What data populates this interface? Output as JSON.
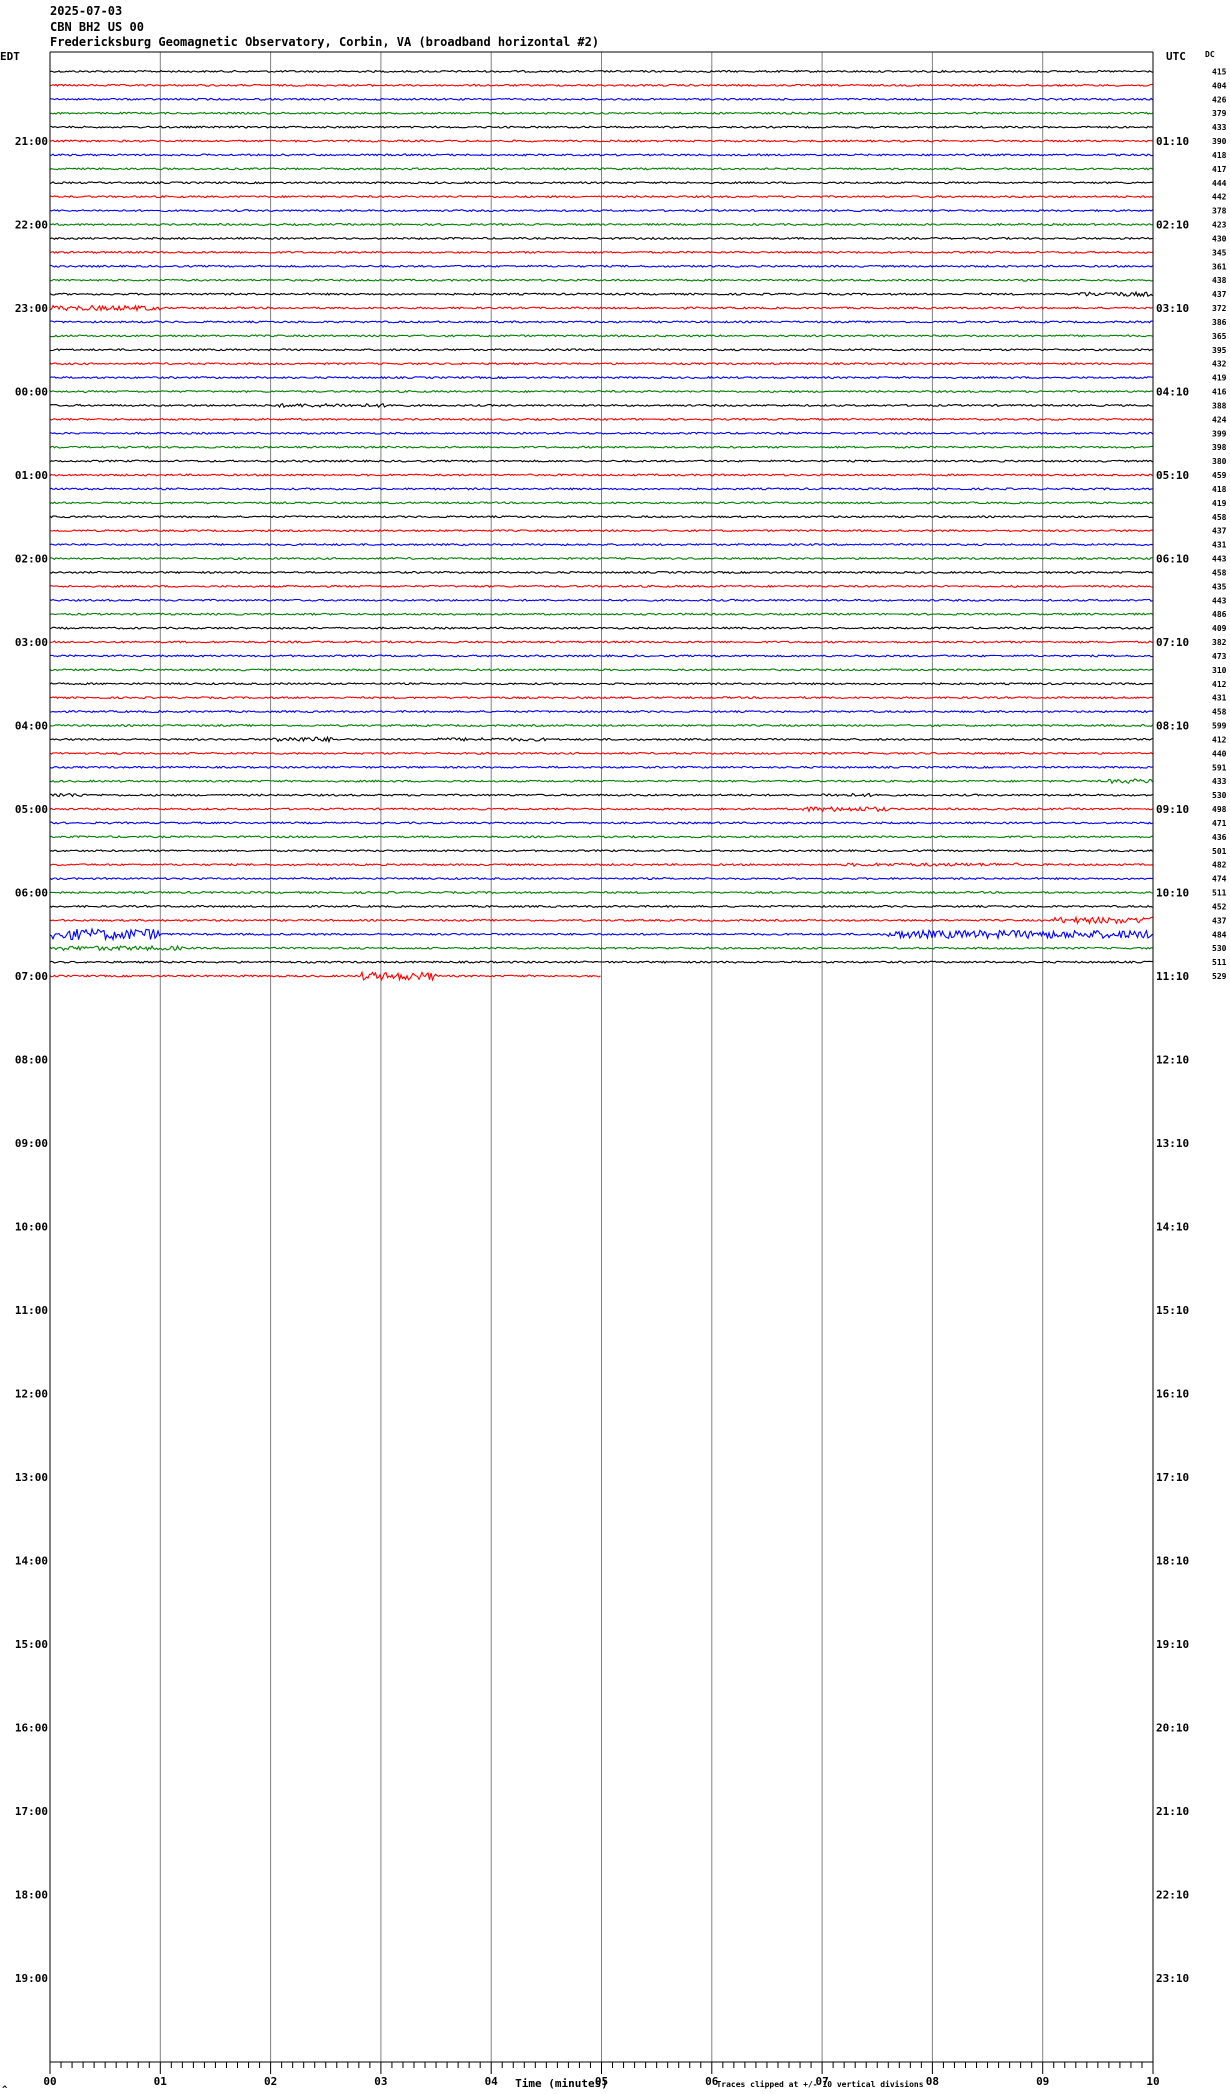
{
  "header": {
    "date": "2025-07-03",
    "channel": "CBN BH2 US 00",
    "station": "Fredericksburg Geomagnetic Observatory, Corbin, VA (broadband horizontal #2)"
  },
  "left_tz": "EDT",
  "right_tz": "UTC",
  "dc_label": "DC",
  "footnote": "Traces clipped at +/- 10 vertical divisions",
  "corner_mark": "^",
  "colors": [
    "#000000",
    "#ff0000",
    "#0000ff",
    "#008000"
  ],
  "chart_data": {
    "type": "line",
    "title": "CBN BH2 US 00",
    "xlabel": "Time (minutes)",
    "ylabel": "",
    "x_ticks": [
      "00",
      "01",
      "02",
      "03",
      "04",
      "05",
      "06",
      "07",
      "08",
      "09",
      "10"
    ],
    "xlim": [
      0,
      10
    ],
    "left_hour_labels": [
      "21:00",
      "22:00",
      "23:00",
      "00:00",
      "01:00",
      "02:00",
      "03:00",
      "04:00",
      "05:00",
      "06:00",
      "07:00",
      "08:00",
      "09:00",
      "10:00",
      "11:00",
      "12:00",
      "13:00",
      "14:00",
      "15:00",
      "16:00",
      "17:00",
      "18:00",
      "19:00"
    ],
    "right_hour_labels": [
      "01:10",
      "02:10",
      "03:10",
      "04:10",
      "05:10",
      "06:10",
      "07:10",
      "08:10",
      "09:10",
      "10:10",
      "11:10",
      "12:10",
      "13:10",
      "14:10",
      "15:10",
      "16:10",
      "17:10",
      "18:10",
      "19:10",
      "20:10",
      "21:10",
      "22:10",
      "23:10"
    ],
    "dc_offsets": [
      415,
      404,
      426,
      379,
      433,
      390,
      418,
      417,
      444,
      442,
      378,
      423,
      430,
      345,
      361,
      438,
      437,
      372,
      386,
      365,
      395,
      432,
      419,
      416,
      388,
      424,
      399,
      398,
      380,
      459,
      418,
      419,
      458,
      437,
      431,
      443,
      458,
      435,
      443,
      486,
      409,
      382,
      473,
      310,
      412,
      431,
      458,
      599,
      412,
      440,
      591,
      433,
      530,
      498,
      471,
      436,
      501,
      482,
      474,
      511,
      452,
      437,
      484,
      530,
      511,
      529
    ],
    "rows_per_hour": 6,
    "total_traces": 66,
    "last_trace_minutes": 5,
    "events": [
      {
        "trace": 16,
        "minute_start": 9.3,
        "minute_end": 10,
        "amp": 2.2
      },
      {
        "trace": 17,
        "minute_start": 0,
        "minute_end": 1.0,
        "amp": 2.5
      },
      {
        "trace": 24,
        "minute_start": 2.0,
        "minute_end": 3.2,
        "amp": 1.8
      },
      {
        "trace": 48,
        "minute_start": 2.0,
        "minute_end": 2.6,
        "amp": 2.4
      },
      {
        "trace": 48,
        "minute_start": 3.5,
        "minute_end": 4.5,
        "amp": 1.6
      },
      {
        "trace": 51,
        "minute_start": 9.6,
        "minute_end": 10,
        "amp": 2.2
      },
      {
        "trace": 52,
        "minute_start": 0,
        "minute_end": 0.3,
        "amp": 2.0
      },
      {
        "trace": 52,
        "minute_start": 7.0,
        "minute_end": 7.6,
        "amp": 1.6
      },
      {
        "trace": 53,
        "minute_start": 6.8,
        "minute_end": 7.6,
        "amp": 2.4
      },
      {
        "trace": 57,
        "minute_start": 7.2,
        "minute_end": 8.8,
        "amp": 1.6
      },
      {
        "trace": 61,
        "minute_start": 9.1,
        "minute_end": 10,
        "amp": 3.2
      },
      {
        "trace": 62,
        "minute_start": 0,
        "minute_end": 1.0,
        "amp": 5.5
      },
      {
        "trace": 62,
        "minute_start": 7.6,
        "minute_end": 10,
        "amp": 4.0
      },
      {
        "trace": 63,
        "minute_start": 0,
        "minute_end": 1.2,
        "amp": 2.2
      },
      {
        "trace": 65,
        "minute_start": 2.8,
        "minute_end": 3.5,
        "amp": 4.0
      }
    ]
  }
}
